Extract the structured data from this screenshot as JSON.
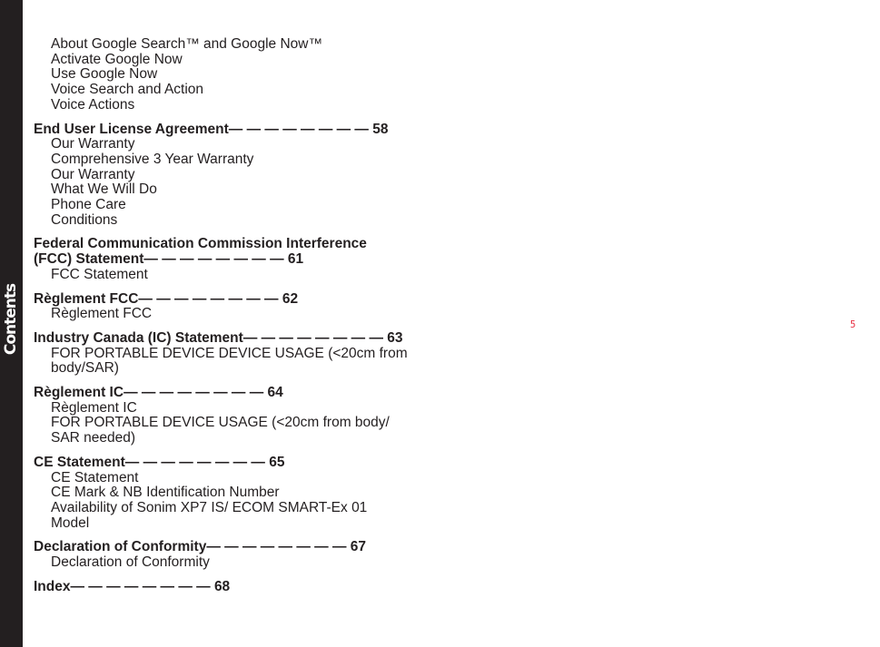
{
  "sidebar": {
    "label": "Contents"
  },
  "page_number": "5",
  "intro_items": [
    "About Google Search™ and Google Now™",
    "Activate Google Now",
    "Use Google Now",
    "Voice Search and Action",
    "Voice Actions"
  ],
  "sections": [
    {
      "title": "End User License Agreement",
      "page": "58",
      "items": [
        "Our Warranty",
        "Comprehensive 3 Year Warranty",
        "Our Warranty",
        "What We Will Do",
        "Phone Care",
        "Conditions"
      ]
    },
    {
      "title_line1": "Federal Communication Commission Interference",
      "title": "(FCC) Statement",
      "page": "61",
      "items": [
        "FCC Statement"
      ]
    },
    {
      "title": "Règlement FCC",
      "page": "62",
      "items": [
        "Règlement FCC"
      ]
    },
    {
      "title": "Industry Canada (IC) Statement",
      "page": "63",
      "items": [
        "FOR PORTABLE DEVICE DEVICE USAGE (<20cm from body/SAR)"
      ]
    },
    {
      "title": "Règlement IC",
      "page": "64",
      "items": [
        "Règlement IC",
        "FOR PORTABLE DEVICE USAGE (<20cm from body/ SAR needed)"
      ]
    },
    {
      "title": "CE Statement",
      "page": "65",
      "items": [
        "CE Statement",
        "CE Mark & NB Identification Number",
        "Availability of Sonim XP7 IS/ ECOM SMART-Ex 01 Model"
      ]
    },
    {
      "title": "Declaration of Conformity",
      "page": "67",
      "items": [
        "Declaration of Conformity"
      ]
    },
    {
      "title": "Index",
      "page": "68",
      "items": []
    }
  ],
  "leader": "— — — — — — — — "
}
